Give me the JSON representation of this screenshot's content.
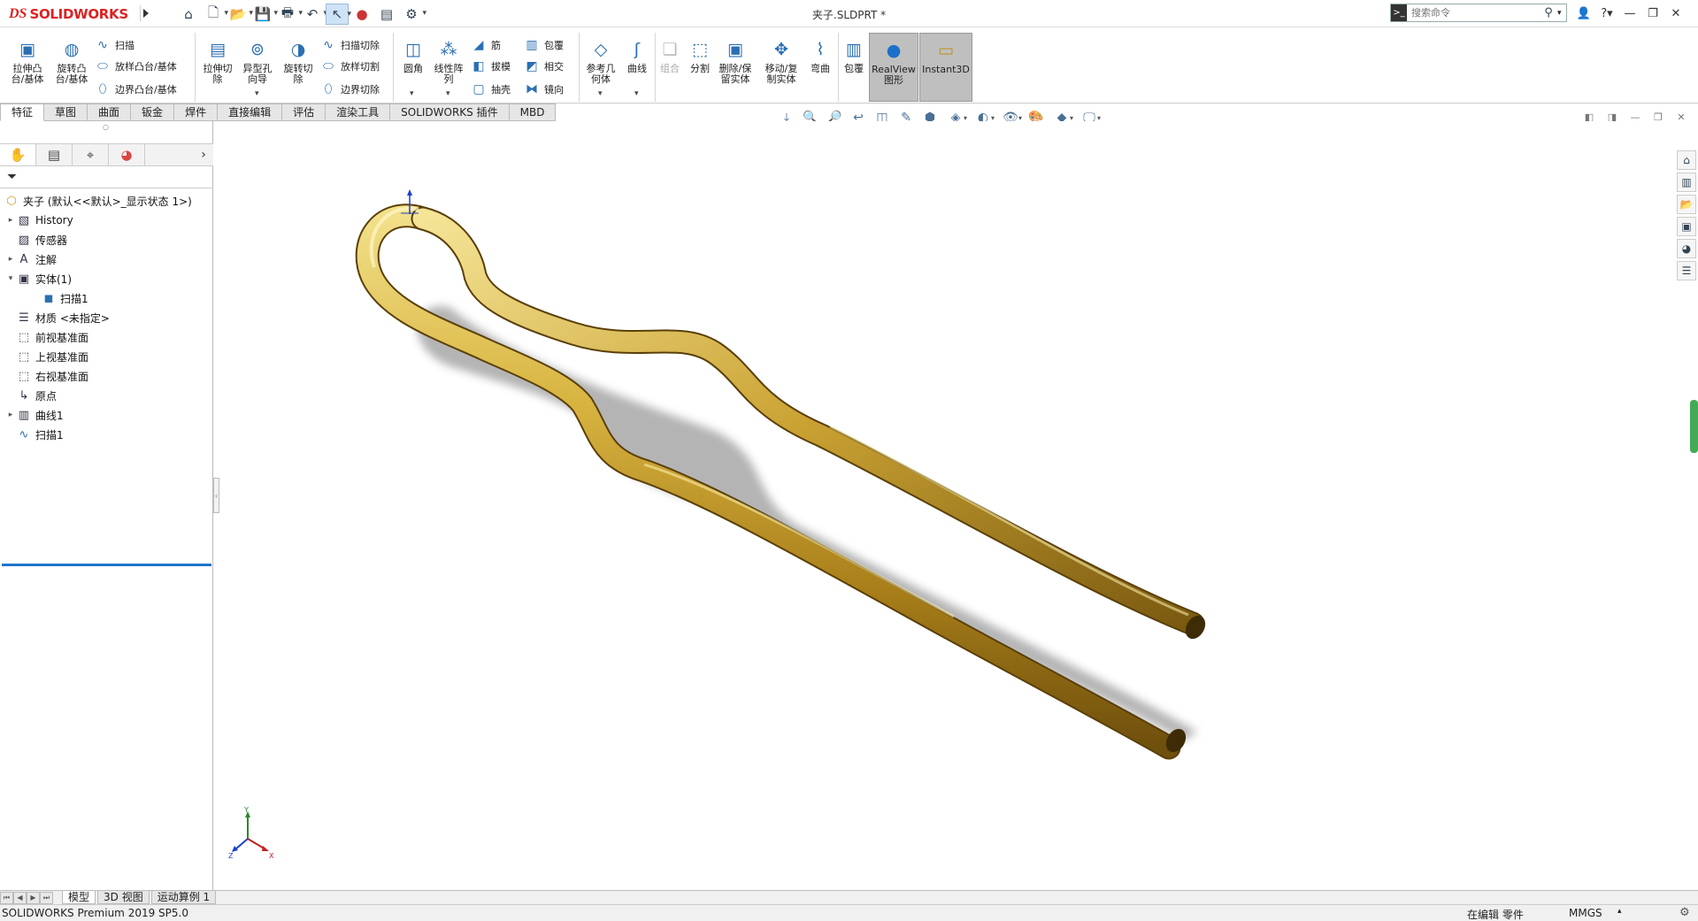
{
  "app": {
    "logo_ds": "DS",
    "logo_text": "SOLIDWORKS",
    "document_title": "夹子.SLDPRT *"
  },
  "search": {
    "placeholder": "搜索命令",
    "cmd_icon": "command-icon"
  },
  "commands": {
    "extrude_boss": "拉伸凸\n台/基体",
    "revolve_boss": "旋转凸\n台/基体",
    "sweep": "扫描",
    "loft_boss": "放样凸台/基体",
    "boundary_boss": "边界凸台/基体",
    "extrude_cut": "拉伸切\n除",
    "hole_wizard": "异型孔\n向导",
    "revolve_cut": "旋转切\n除",
    "swept_cut": "扫描切除",
    "lofted_cut": "放样切割",
    "boundary_cut": "边界切除",
    "fillet": "圆角",
    "linear_pattern": "线性阵\n列",
    "rib": "筋",
    "draft": "拔模",
    "shell": "抽壳",
    "wrap": "包覆",
    "intersect": "相交",
    "mirror": "镜向",
    "ref_geometry": "参考几\n何体",
    "curves": "曲线",
    "combine": "组合",
    "split": "分割",
    "delete_keep_body": "删除/保\n留实体",
    "move_copy_body": "移动/复\n制实体",
    "flex": "弯曲",
    "wrap2": "包覆",
    "realview": "RealView\n图形",
    "instant3d": "Instant3D"
  },
  "tabs": [
    "特征",
    "草图",
    "曲面",
    "钣金",
    "焊件",
    "直接编辑",
    "评估",
    "渲染工具",
    "SOLIDWORKS 插件",
    "MBD"
  ],
  "tree": {
    "root": "夹子  (默认<<默认>_显示状态 1>)",
    "items": [
      {
        "label": "History",
        "icon": "history-icon",
        "expandable": true
      },
      {
        "label": "传感器",
        "icon": "sensor-icon",
        "expandable": false
      },
      {
        "label": "注解",
        "icon": "annotation-icon",
        "expandable": true
      },
      {
        "label": "实体(1)",
        "icon": "solid-bodies-icon",
        "expandable": true,
        "expanded": true
      },
      {
        "label": "扫描1",
        "icon": "body-icon",
        "expandable": false,
        "child": true
      },
      {
        "label": "材质 <未指定>",
        "icon": "material-icon",
        "expandable": false
      },
      {
        "label": "前视基准面",
        "icon": "plane-icon",
        "expandable": false
      },
      {
        "label": "上视基准面",
        "icon": "plane-icon",
        "expandable": false
      },
      {
        "label": "右视基准面",
        "icon": "plane-icon",
        "expandable": false
      },
      {
        "label": "原点",
        "icon": "origin-icon",
        "expandable": false
      },
      {
        "label": "曲线1",
        "icon": "curve-icon",
        "expandable": true
      },
      {
        "label": "扫描1",
        "icon": "sweep-icon",
        "expandable": false
      }
    ]
  },
  "bottom_tabs": [
    "模型",
    "3D 视图",
    "运动算例 1"
  ],
  "status": {
    "product": "SOLIDWORKS Premium 2019 SP5.0",
    "editing": "在编辑 零件",
    "units": "MMGS"
  },
  "triad": {
    "y": "Y",
    "x": "X",
    "z": "Z"
  },
  "colors": {
    "brand": "#d22222",
    "model_gold": "#c9a227",
    "selection_blue": "#1e74c8"
  }
}
